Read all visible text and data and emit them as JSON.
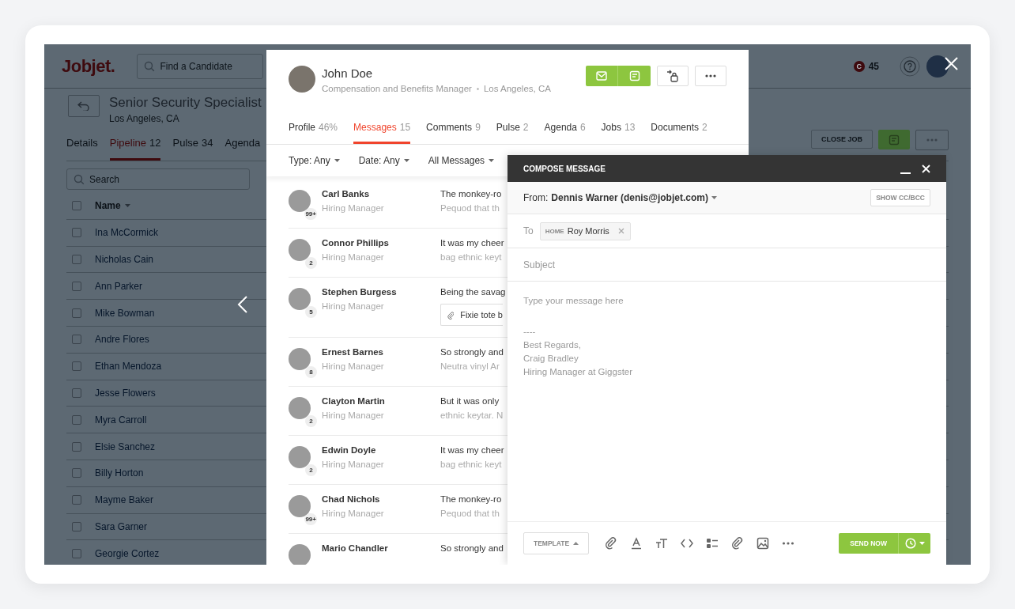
{
  "background_app": {
    "logo": "Jobjet.",
    "search": {
      "placeholder": "Find a Candidate"
    },
    "credits": {
      "symbol": "C",
      "count": "45"
    },
    "job": {
      "title": "Senior Security Specialist",
      "location": "Los Angeles, CA"
    },
    "tabs": [
      {
        "label": "Details",
        "selected": false
      },
      {
        "label": "Pipeline",
        "count": "12",
        "selected": true
      },
      {
        "label": "Pulse",
        "count": "34",
        "selected": false
      },
      {
        "label": "Agenda",
        "selected": false
      }
    ],
    "actions": {
      "close_job": "CLOSE JOB"
    },
    "table_search": {
      "placeholder": "Search"
    },
    "table": {
      "select_all": {
        "checked": false
      },
      "columns": [
        {
          "label": "Name"
        }
      ],
      "rows": [
        {
          "name": "Ina McCormick",
          "checked": false
        },
        {
          "name": "Nicholas Cain",
          "checked": false
        },
        {
          "name": "Ann Parker",
          "checked": false
        },
        {
          "name": "Mike Bowman",
          "checked": false
        },
        {
          "name": "Andre Flores",
          "checked": false
        },
        {
          "name": "Ethan Mendoza",
          "checked": false
        },
        {
          "name": "Jesse Flowers",
          "checked": false
        },
        {
          "name": "Myra Carroll",
          "checked": false
        },
        {
          "name": "Elsie Sanchez",
          "checked": false
        },
        {
          "name": "Billy Horton",
          "checked": false
        },
        {
          "name": "Mayme Baker",
          "checked": false
        },
        {
          "name": "Sara Garner",
          "checked": false
        },
        {
          "name": "Georgie Cortez",
          "checked": false
        }
      ]
    }
  },
  "profile_panel": {
    "name": "John Doe",
    "title": "Compensation and Benefits Manager",
    "location": "Los Angeles, CA",
    "tabs": [
      {
        "label": "Profile",
        "count": "46%",
        "selected": false
      },
      {
        "label": "Messages",
        "count": "15",
        "selected": true
      },
      {
        "label": "Comments",
        "count": "9",
        "selected": false
      },
      {
        "label": "Pulse",
        "count": "2",
        "selected": false
      },
      {
        "label": "Agenda",
        "count": "6",
        "selected": false
      },
      {
        "label": "Jobs",
        "count": "13",
        "selected": false
      },
      {
        "label": "Documents",
        "count": "2",
        "selected": false
      }
    ],
    "filters": [
      "Type: Any",
      "Date: Any",
      "All Messages"
    ],
    "messages": [
      {
        "name": "Carl Banks",
        "role": "Hiring Manager",
        "count": "99+",
        "preview": [
          "The monkey-ro",
          "Pequod that th"
        ]
      },
      {
        "name": "Connor Phillips",
        "role": "Hiring Manager",
        "count": "2",
        "preview": [
          "It was my cheer",
          "bag ethnic keyt"
        ]
      },
      {
        "name": "Stephen Burgess",
        "role": "Hiring Manager",
        "count": "5",
        "preview": [
          "Being the savag"
        ],
        "attachment": "Fixie tote b"
      },
      {
        "name": "Ernest Barnes",
        "role": "Hiring Manager",
        "count": "8",
        "preview": [
          "So strongly and",
          "Neutra vinyl Ar"
        ]
      },
      {
        "name": "Clayton Martin",
        "role": "Hiring Manager",
        "count": "2",
        "preview": [
          "But it was only",
          "ethnic keytar. N"
        ]
      },
      {
        "name": "Edwin Doyle",
        "role": "Hiring Manager",
        "count": "2",
        "preview": [
          "It was my cheer",
          "bag ethnic keyt"
        ]
      },
      {
        "name": "Chad Nichols",
        "role": "Hiring Manager",
        "count": "99+",
        "preview": [
          "The monkey-ro",
          "Pequod that th"
        ]
      },
      {
        "name": "Mario Chandler",
        "preview": [
          "So strongly and"
        ]
      }
    ]
  },
  "compose": {
    "title": "COMPOSE MESSAGE",
    "from_label": "From:",
    "from_value": "Dennis Warner (denis@jobjet.com)",
    "cc_bcc": "SHOW CC/BCC",
    "to_label": "To",
    "recipients": [
      {
        "tag": "HOME",
        "name": "Roy Morris"
      }
    ],
    "subject": {
      "placeholder": "Subject"
    },
    "body": {
      "placeholder": "Type your message here",
      "signature": [
        "----",
        "Best Regards,",
        "Craig Bradley",
        "Hiring Manager at Giggster"
      ]
    },
    "template": "TEMPLATE",
    "send": "SEND NOW"
  }
}
